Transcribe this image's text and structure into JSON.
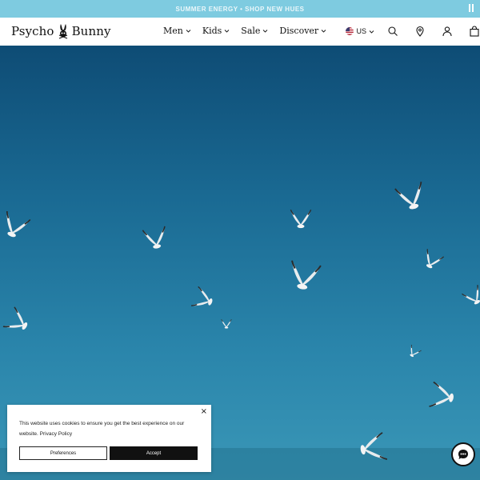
{
  "announcement": {
    "text": "SUMMER ENERGY • SHOP NEW HUES",
    "pause_icon": "pause-icon",
    "bg_color": "#7ecbe0"
  },
  "header": {
    "logo_left": "Psycho",
    "logo_right": "Bunny",
    "logo_icon": "bunny-skull-icon",
    "nav": [
      {
        "label": "Men"
      },
      {
        "label": "Kids"
      },
      {
        "label": "Sale"
      },
      {
        "label": "Discover"
      }
    ],
    "region": "US",
    "icons": [
      "search-icon",
      "store-locator-icon",
      "account-icon",
      "cart-icon"
    ]
  },
  "hero": {
    "image": "seagulls flying over ocean",
    "sky_color": "#1a6a93"
  },
  "cookie_banner": {
    "message": "This website uses cookies to ensure you get the best experience on our website.",
    "policy_link": "Privacy Policy",
    "preferences_label": "Preferences",
    "accept_label": "Accept",
    "close_label": "×"
  },
  "chat": {
    "icon": "chat-bubble-icon"
  }
}
